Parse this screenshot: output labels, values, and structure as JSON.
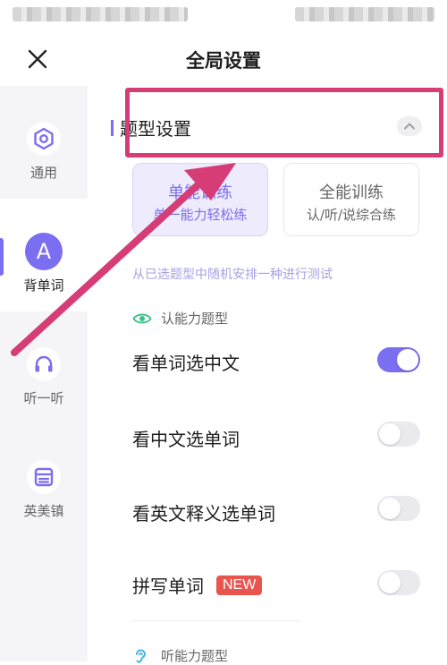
{
  "status_bar": {},
  "header": {
    "title": "全局设置"
  },
  "sidebar": {
    "items": [
      {
        "label": "通用",
        "icon": "settings-hexagon-icon",
        "active": false
      },
      {
        "label": "背单词",
        "icon": "avatar-a",
        "avatar_letter": "A",
        "active": true
      },
      {
        "label": "听一听",
        "icon": "headphones-icon",
        "active": false
      },
      {
        "label": "英美镇",
        "icon": "book-icon",
        "active": false
      }
    ]
  },
  "main": {
    "section_title": "题型设置",
    "modes": [
      {
        "title": "单能训练",
        "subtitle": "单一能力轻松练",
        "selected": true
      },
      {
        "title": "全能训练",
        "subtitle": "认/听/说综合练",
        "selected": false
      }
    ],
    "description": "从已选题型中随机安排一种进行测试",
    "groups": [
      {
        "title": "认能力题型",
        "icon": "eye-icon",
        "options": [
          {
            "label": "看单词选中文",
            "enabled": true
          },
          {
            "label": "看中文选单词",
            "enabled": false
          },
          {
            "label": "看英文释义选单词",
            "enabled": false
          },
          {
            "label": "拼写单词",
            "badge": "NEW",
            "enabled": false
          }
        ]
      },
      {
        "title": "听能力题型",
        "icon": "ear-icon",
        "options": []
      }
    ]
  },
  "colors": {
    "accent": "#7b6ef0",
    "accent_light": "#eeebfd",
    "annotation": "#d63c75",
    "badge_red": "#e8554f"
  }
}
